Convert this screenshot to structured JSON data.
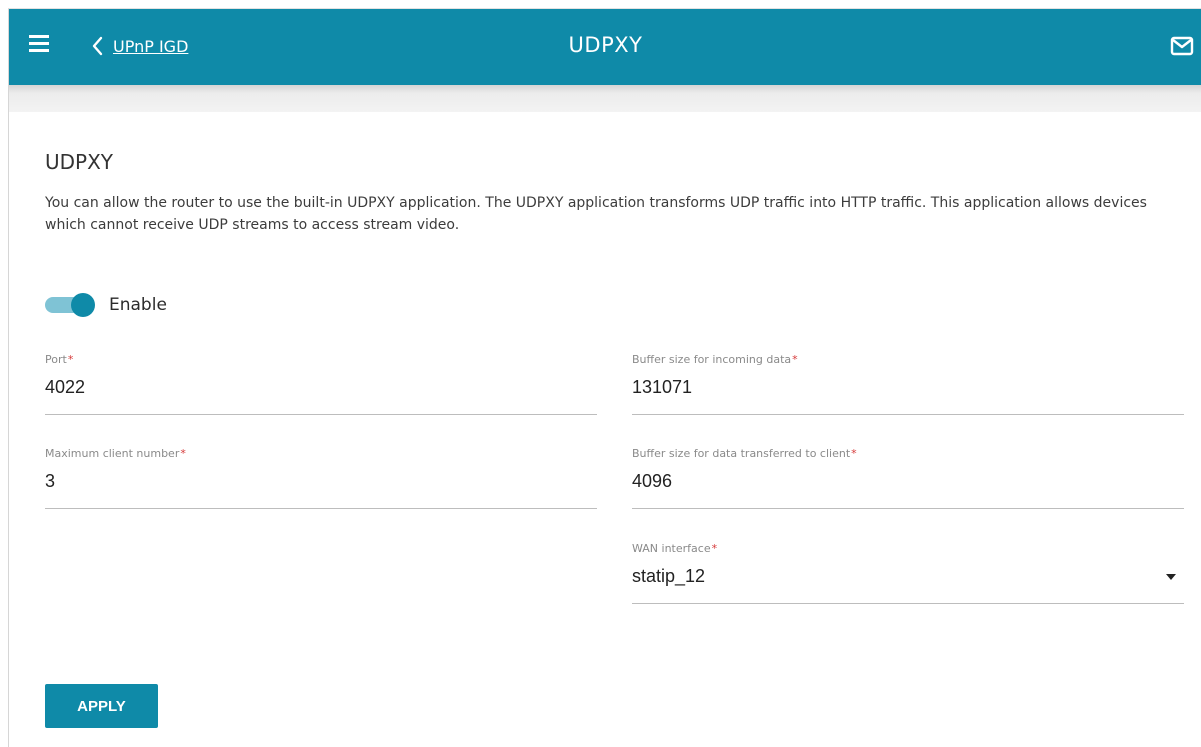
{
  "header": {
    "back_label": "UPnP IGD",
    "title": "UDPXY",
    "colors": {
      "bar": "#0f8aa8",
      "text": "#ffffff"
    },
    "icons": [
      "menu-icon",
      "chevron-left-icon",
      "mail-icon"
    ]
  },
  "section": {
    "title": "UDPXY",
    "description": "You can allow the router to use the built-in UDPXY application. The UDPXY application transforms UDP traffic into HTTP traffic. This application allows devices which cannot receive UDP streams to access stream video."
  },
  "enable": {
    "label": "Enable",
    "checked": true
  },
  "fields": {
    "port": {
      "label": "Port",
      "required": "*",
      "value": "4022"
    },
    "buffer_in": {
      "label": "Buffer size for incoming data",
      "required": "*",
      "value": "131071"
    },
    "max_clients": {
      "label": "Maximum client number",
      "required": "*",
      "value": "3"
    },
    "buffer_out": {
      "label": "Buffer size for data transferred to client",
      "required": "*",
      "value": "4096"
    },
    "wan": {
      "label": "WAN interface",
      "required": "*",
      "value": "statip_12"
    }
  },
  "apply_label": "APPLY",
  "accent_color": "#0f8aa8"
}
